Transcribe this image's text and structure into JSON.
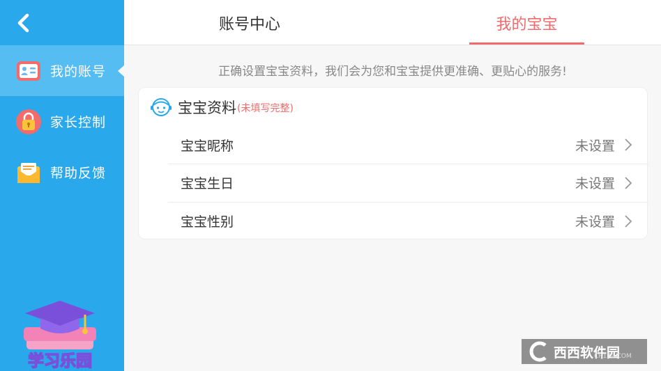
{
  "sidebar": {
    "items": [
      {
        "label": "我的账号",
        "icon": "id-card-icon"
      },
      {
        "label": "家长控制",
        "icon": "lock-icon"
      },
      {
        "label": "帮助反馈",
        "icon": "envelope-icon"
      }
    ],
    "logo_text": "学习乐园"
  },
  "tabs": {
    "account": "账号中心",
    "baby": "我的宝宝"
  },
  "hint": "正确设置宝宝资料，我们会为您和宝宝提供更准确、更贴心的服务!",
  "card": {
    "title": "宝宝资料",
    "subtitle": "(未填写完整)",
    "rows": [
      {
        "label": "宝宝昵称",
        "value": "未设置"
      },
      {
        "label": "宝宝生日",
        "value": "未设置"
      },
      {
        "label": "宝宝性别",
        "value": "未设置"
      }
    ]
  },
  "watermark": {
    "text": "西西软件园",
    "small": "CR173.COM"
  },
  "colors": {
    "sidebar": "#2aa8ec",
    "active": "#55bdf2",
    "accent": "#f06b6b"
  }
}
